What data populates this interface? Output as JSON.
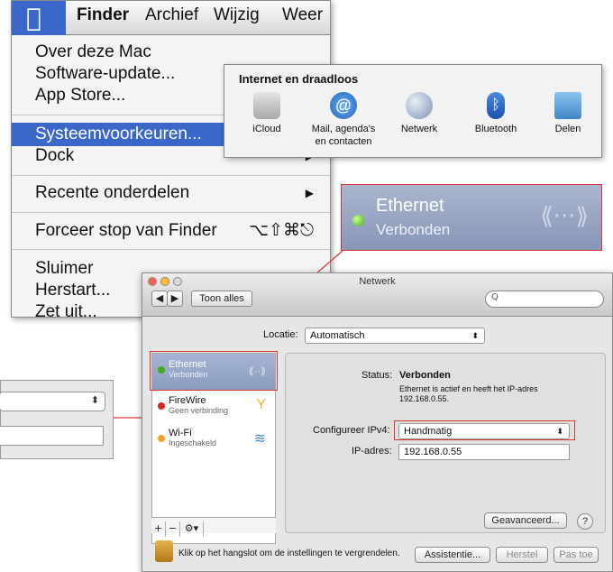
{
  "menubar": {
    "apple_glyph": "",
    "items": [
      "Finder",
      "Archief",
      "Wijzig",
      "Weer"
    ]
  },
  "finder_menu": {
    "items": [
      {
        "label": "Over deze Mac"
      },
      {
        "label": "Software-update..."
      },
      {
        "label": "App Store..."
      },
      {
        "label": "Systeemvoorkeuren..."
      },
      {
        "label": "Dock"
      },
      {
        "label": "Recente onderdelen",
        "shortcut": "▶"
      },
      {
        "label": "Forceer stop van Finder",
        "shortcut": "⌥⇧⌘⎋"
      },
      {
        "label": "Sluimer"
      },
      {
        "label": "Herstart..."
      },
      {
        "label": "Zet uit..."
      }
    ],
    "selected_index": 3
  },
  "internet_panel": {
    "title": "Internet en draadloos",
    "items": [
      {
        "label": "iCloud",
        "icon": "icloud-icon",
        "color": "#c9c9c9"
      },
      {
        "label": "Mail, agenda's en contacten",
        "icon": "at-icon",
        "color": "#3a86d6"
      },
      {
        "label": "Netwerk",
        "icon": "globe-icon",
        "color": "#8fa7c4"
      },
      {
        "label": "Bluetooth",
        "icon": "bluetooth-icon",
        "color": "#2b67c8"
      },
      {
        "label": "Delen",
        "icon": "sharing-folder-icon",
        "color": "#5aa0d8"
      }
    ]
  },
  "ethernet_callout": {
    "name": "Ethernet",
    "status": "Verbonden"
  },
  "network_window": {
    "title": "Netwerk",
    "show_all": "Toon alles",
    "back": "◀",
    "forward": "▶",
    "search_glyph": "Q",
    "location_label": "Locatie:",
    "location_value": "Automatisch",
    "services": [
      {
        "name": "Ethernet",
        "status": "Verbonden",
        "dot": "#3fae17",
        "icon": "⟪···⟫"
      },
      {
        "name": "FireWire",
        "status": "Geen verbinding",
        "dot": "#d22",
        "icon": "✦"
      },
      {
        "name": "Wi-Fi",
        "status": "Ingeschakeld",
        "dot": "#f0a020",
        "icon": "◠"
      }
    ],
    "status_label": "Status:",
    "status_value": "Verbonden",
    "status_desc": "Ethernet is actief en heeft het IP-adres 192.168.0.55.",
    "configure_label": "Configureer IPv4:",
    "configure_value": "Handmatig",
    "ip_label": "IP-adres:",
    "ip_value": "192.168.0.55",
    "advanced_button": "Geavanceerd...",
    "help_button": "?",
    "lock_text": "Klik op het hangslot om de instellingen te vergrendelen.",
    "assist_button": "Assistentie...",
    "revert_button": "Herstel",
    "apply_button": "Pas toe",
    "list_buttons": [
      "+",
      "−",
      "⚙▾"
    ]
  },
  "colors": {
    "selection": "#3b67c9",
    "highlight": "#d33333"
  }
}
